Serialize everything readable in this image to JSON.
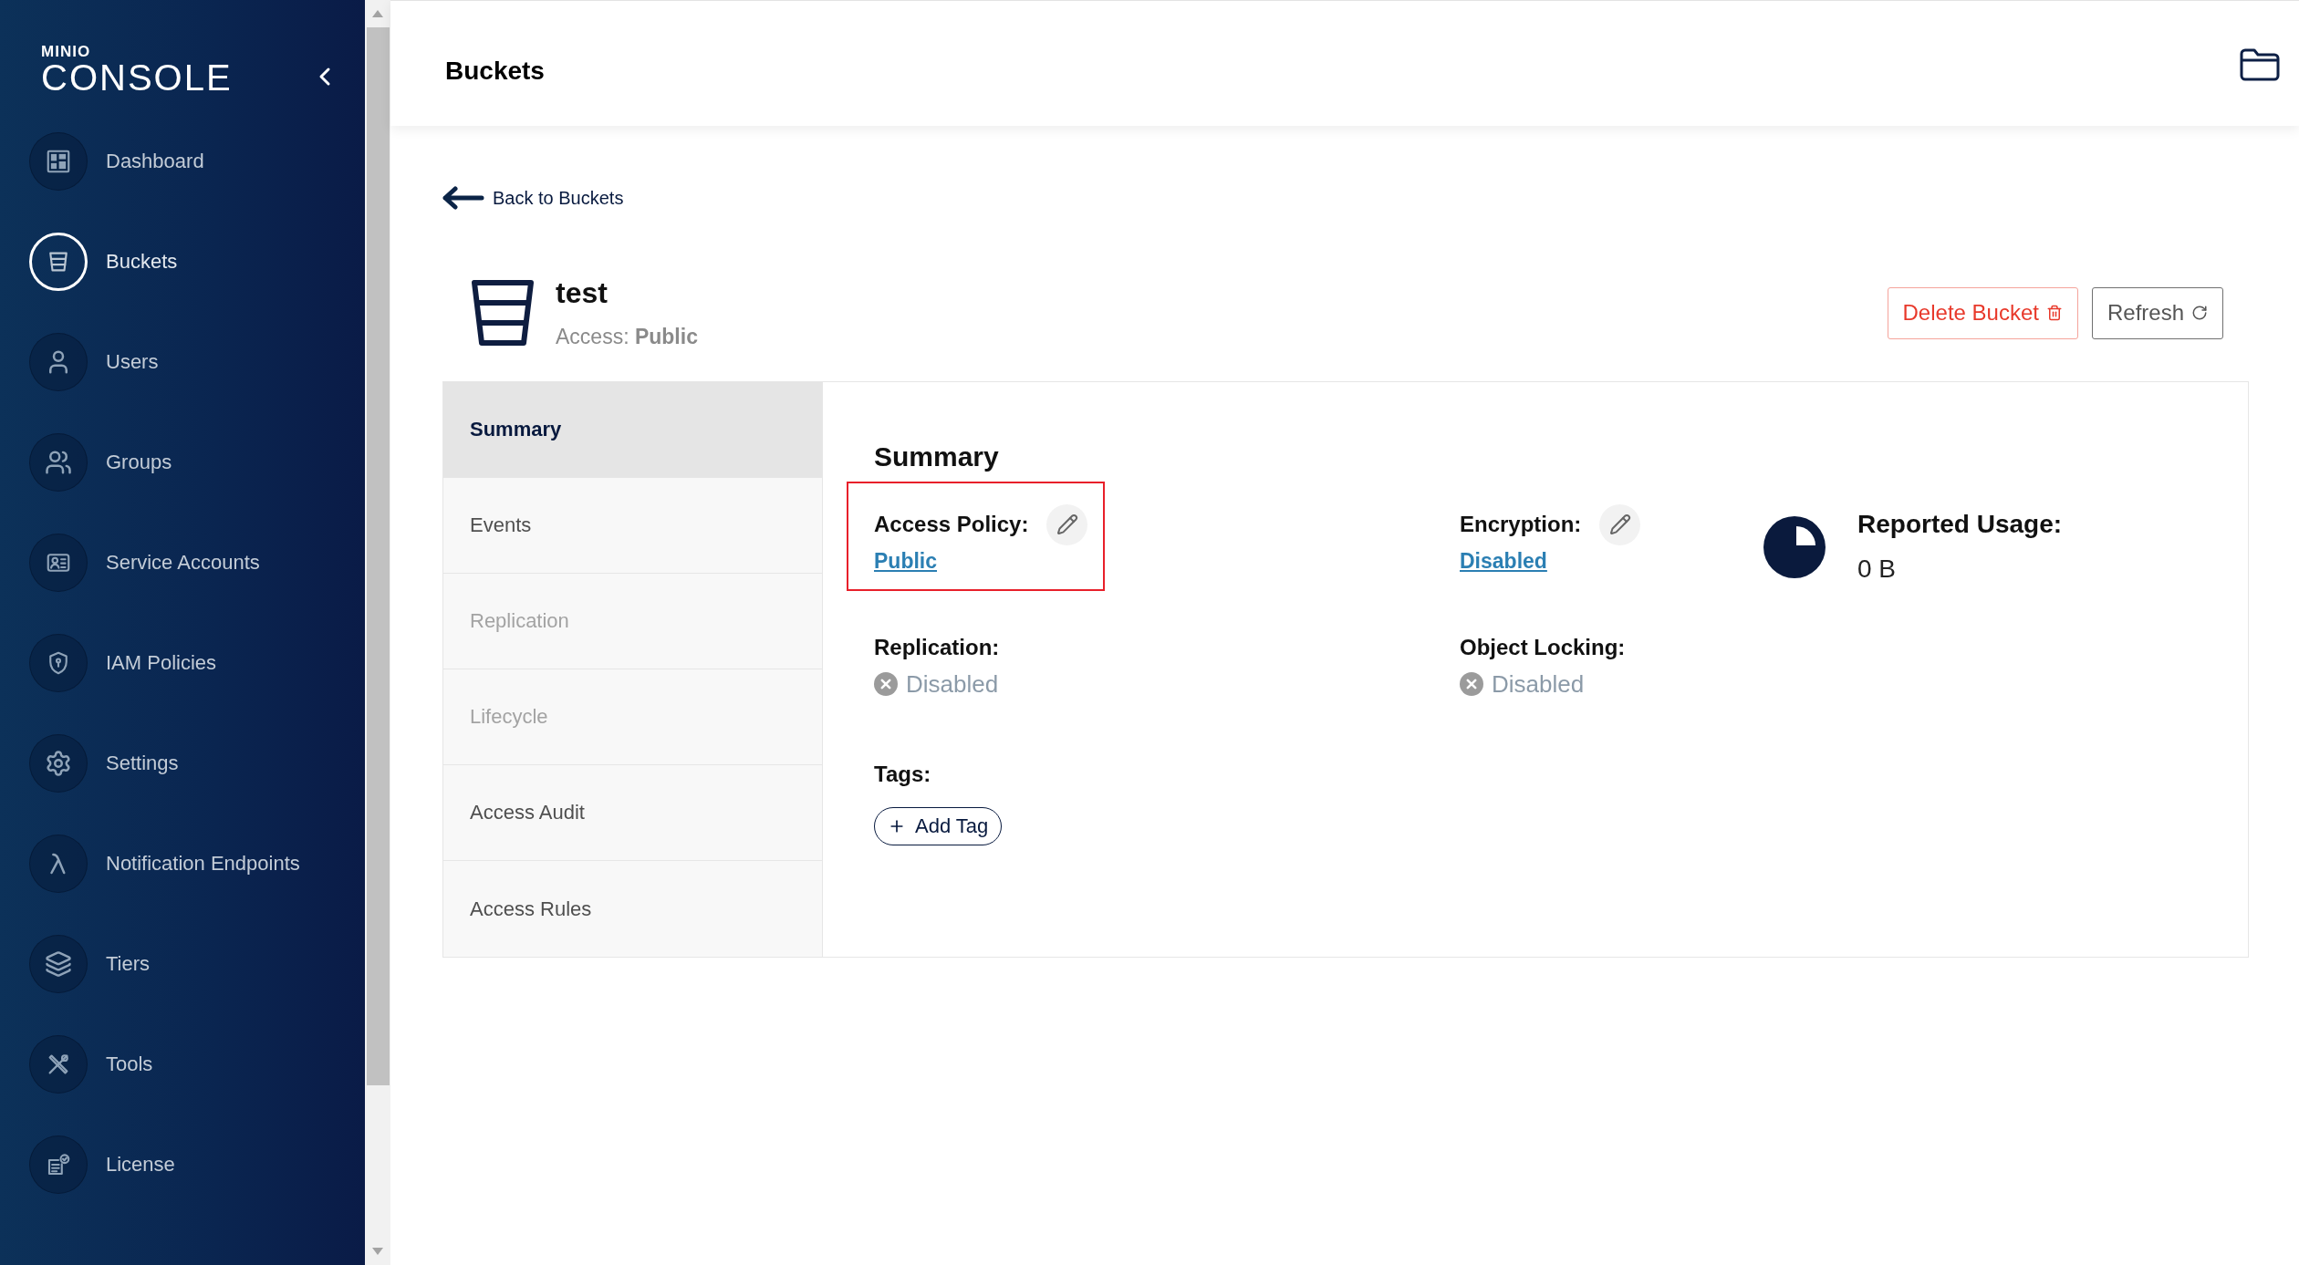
{
  "sidebar": {
    "logo": {
      "brand": "MINIO",
      "product": "CONSOLE"
    },
    "items": [
      {
        "label": "Dashboard",
        "selected": false
      },
      {
        "label": "Buckets",
        "selected": true
      },
      {
        "label": "Users",
        "selected": false
      },
      {
        "label": "Groups",
        "selected": false
      },
      {
        "label": "Service Accounts",
        "selected": false
      },
      {
        "label": "IAM Policies",
        "selected": false
      },
      {
        "label": "Settings",
        "selected": false
      },
      {
        "label": "Notification Endpoints",
        "selected": false
      },
      {
        "label": "Tiers",
        "selected": false
      },
      {
        "label": "Tools",
        "selected": false
      },
      {
        "label": "License",
        "selected": false
      }
    ]
  },
  "header": {
    "title": "Buckets"
  },
  "back_link": "Back to Buckets",
  "bucket": {
    "name": "test",
    "access": "Access: **Public**"
  },
  "actions": [
    {
      "kind": "danger",
      "label": "Delete Bucket"
    },
    {
      "kind": "default",
      "label": "Refresh"
    }
  ],
  "tabs": [
    {
      "label": "Summary",
      "selected": true,
      "disabled": false
    },
    {
      "label": "Events",
      "selected": false,
      "disabled": false
    },
    {
      "label": "Replication",
      "selected": false,
      "disabled": true
    },
    {
      "label": "Lifecycle",
      "selected": false,
      "disabled": true
    },
    {
      "label": "Access Audit",
      "selected": false,
      "disabled": false
    },
    {
      "label": "Access Rules",
      "selected": false,
      "disabled": false
    }
  ],
  "summary": {
    "title": "Summary",
    "fields": [
      {
        "kind": "editable",
        "label": "Access Policy:",
        "value": "Public",
        "highlighted": true
      },
      {
        "kind": "editable",
        "label": "Encryption:",
        "value": "Disabled",
        "highlighted": false
      },
      {
        "kind": "status",
        "label": "Replication:",
        "value": "Disabled",
        "highlighted": false
      },
      {
        "kind": "status",
        "label": "Object Locking:",
        "value": "Disabled",
        "highlighted": false
      }
    ],
    "usage": {
      "label": "Reported Usage:",
      "value": "0 B"
    },
    "tags": {
      "label": "Tags:",
      "add_button": "Add Tag"
    }
  }
}
